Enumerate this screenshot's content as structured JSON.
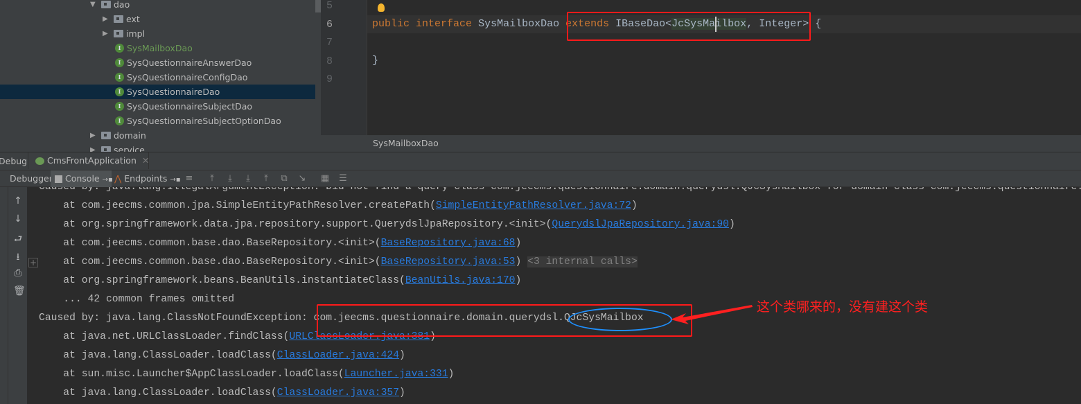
{
  "tree": {
    "items": [
      {
        "label": "dao",
        "type": "folder",
        "expanded": true
      },
      {
        "label": "ext",
        "type": "folder"
      },
      {
        "label": "impl",
        "type": "folder"
      },
      {
        "label": "SysMailboxDao",
        "type": "interface",
        "color": "#6a9955"
      },
      {
        "label": "SysQuestionnaireAnswerDao",
        "type": "interface"
      },
      {
        "label": "SysQuestionnaireConfigDao",
        "type": "interface"
      },
      {
        "label": "SysQuestionnaireDao",
        "type": "interface",
        "selected": true
      },
      {
        "label": "SysQuestionnaireSubjectDao",
        "type": "interface"
      },
      {
        "label": "SysQuestionnaireSubjectOptionDao",
        "type": "interface"
      },
      {
        "label": "domain",
        "type": "folder"
      },
      {
        "label": "service",
        "type": "folder"
      }
    ],
    "interface_glyph": "I"
  },
  "editor": {
    "line_numbers": [
      "5",
      "6",
      "7",
      "8",
      "9"
    ],
    "line6": {
      "kw1": "public",
      "kw2": "interface",
      "name": "SysMailboxDao",
      "kw3": "extends",
      "base": "IBaseDao<",
      "arg1": "JcSysMailbox",
      "rest": ", Integer> {"
    },
    "line8": "}",
    "breadcrumb": "SysMailboxDao"
  },
  "debug": {
    "label": "Debug:",
    "tab": "CmsFrontApplication",
    "tabs": [
      "Debugger",
      "Console",
      "Endpoints"
    ]
  },
  "console": {
    "lines": [
      {
        "text": "Caused by: java.lang.IllegalArgumentException: Did not find a query class com.jeecms.questionnaire.domain.querydsl.QJcSysMailbox for domain class com.jeecms.questionnaire.domain"
      },
      {
        "prefix": "    at com.jeecms.common.jpa.SimpleEntityPathResolver.createPath(",
        "link": "SimpleEntityPathResolver.java:72",
        "suffix": ")"
      },
      {
        "prefix": "    at org.springframework.data.jpa.repository.support.QuerydslJpaRepository.<init>(",
        "link": "QuerydslJpaRepository.java:90",
        "suffix": ")"
      },
      {
        "prefix": "    at com.jeecms.common.base.dao.BaseRepository.<init>(",
        "link": "BaseRepository.java:68",
        "suffix": ")"
      },
      {
        "prefix": "    at com.jeecms.common.base.dao.BaseRepository.<init>(",
        "link": "BaseRepository.java:53",
        "suffix": ") ",
        "fold": "<3 internal calls>"
      },
      {
        "prefix": "    at org.springframework.beans.BeanUtils.instantiateClass(",
        "link": "BeanUtils.java:170",
        "suffix": ")"
      },
      {
        "prefix": "    ... 42 common frames omitted"
      },
      {
        "prefix": "Caused by: java.lang.ClassNotFoundException: com.jeecms.questionnaire.domain.querydsl.QJcSysMailbox"
      },
      {
        "prefix": "    at java.net.URLClassLoader.findClass(",
        "link": "URLClassLoader.java:381",
        "suffix": ")"
      },
      {
        "prefix": "    at java.lang.ClassLoader.loadClass(",
        "link": "ClassLoader.java:424",
        "suffix": ")"
      },
      {
        "prefix": "    at sun.misc.Launcher$AppClassLoader.loadClass(",
        "link": "Launcher.java:331",
        "suffix": ")"
      },
      {
        "prefix": "    at java.lang.ClassLoader.loadClass(",
        "link": "ClassLoader.java:357",
        "suffix": ")"
      }
    ]
  },
  "annotation": {
    "text": "这个类哪来的，没有建这个类",
    "color": "#ff2020",
    "ellipse_color": "#1e90ff"
  }
}
